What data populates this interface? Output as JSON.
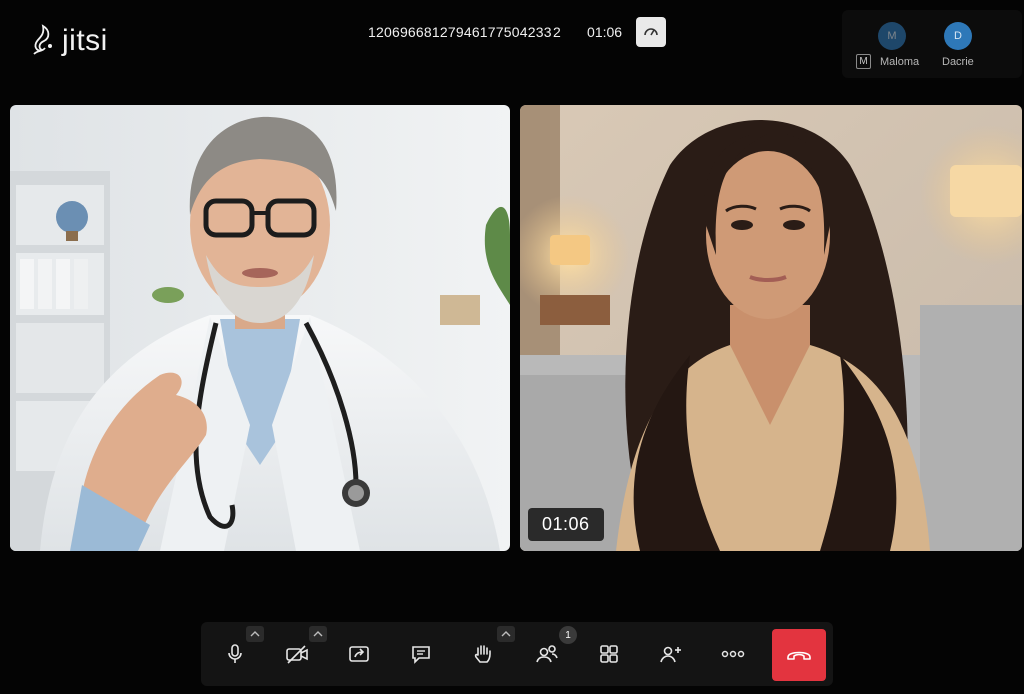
{
  "app": {
    "logo_text": "jitsi"
  },
  "header": {
    "meeting_id": "12069668127946177504233 2",
    "timer": "01:06"
  },
  "participants": [
    {
      "initial": "M",
      "name": "Maloma",
      "badge": "M"
    },
    {
      "initial": "D",
      "name": "Dacrie"
    }
  ],
  "tiles": [
    {
      "role": "doctor"
    },
    {
      "role": "patient",
      "timer": "01:06"
    }
  ],
  "toolbar": {
    "raise_hand_count": "1"
  },
  "colors": {
    "background": "#040404",
    "toolbar": "#141414",
    "hangup": "#e3343f",
    "avatar": "#2e78b8"
  }
}
